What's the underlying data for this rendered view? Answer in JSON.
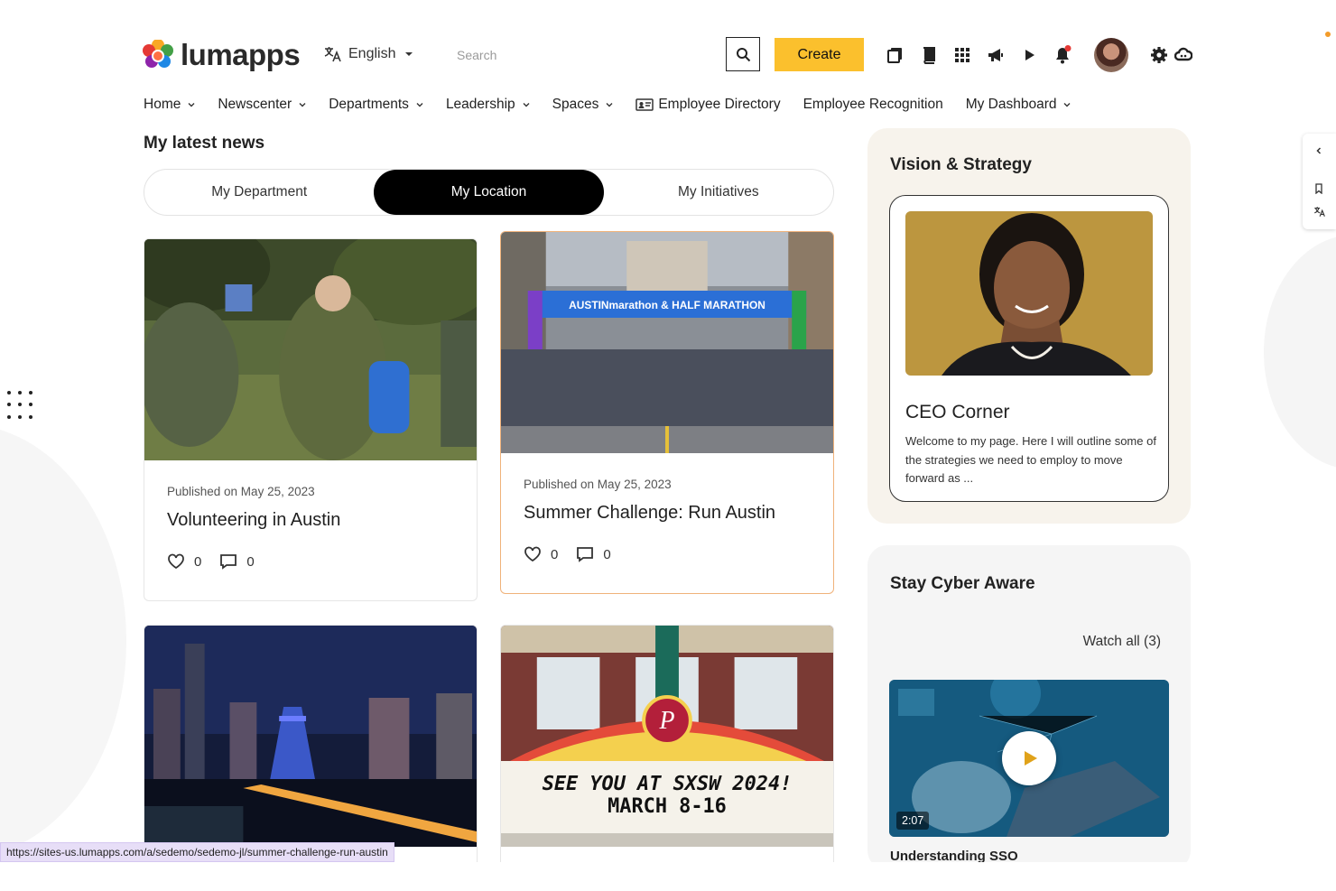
{
  "brand": {
    "name": "lumapps",
    "colors": {
      "accent": "#fbc02d",
      "active_tab": "#000000",
      "notif": "#e53935",
      "highlight_border": "#f0b27a"
    }
  },
  "header": {
    "language": "English",
    "search_placeholder": "Search",
    "create_label": "Create",
    "icons": [
      "pages-icon",
      "book-icon",
      "apps-grid-icon",
      "megaphone-icon",
      "play-icon",
      "bell-icon",
      "settings-icon",
      "cloud-icon"
    ]
  },
  "nav": {
    "items": [
      {
        "label": "Home",
        "dropdown": true
      },
      {
        "label": "Newscenter",
        "dropdown": true
      },
      {
        "label": "Departments",
        "dropdown": true
      },
      {
        "label": "Leadership",
        "dropdown": true
      },
      {
        "label": "Spaces",
        "dropdown": true
      },
      {
        "label": "Employee Directory",
        "dropdown": false
      },
      {
        "label": "Employee Recognition",
        "dropdown": false
      },
      {
        "label": "My Dashboard",
        "dropdown": true
      }
    ]
  },
  "news": {
    "title": "My latest news",
    "tabs": [
      "My Department",
      "My Location",
      "My Initiatives"
    ],
    "active_tab": "My Location",
    "cards": [
      {
        "published": "Published on May 25, 2023",
        "title": "Volunteering in Austin",
        "likes": "0",
        "comments": "0",
        "image": "volunteers-cleanup"
      },
      {
        "published": "Published on May 25, 2023",
        "title": "Summer Challenge: Run Austin",
        "likes": "0",
        "comments": "0",
        "image": "austin-marathon-start",
        "banner": "AUSTINmarathon & HALF MARATHON"
      },
      {
        "image": "austin-skyline-night"
      },
      {
        "image": "paramount-theatre-marquee",
        "marquee_line1": "SEE YOU AT SXSW 2024!",
        "marquee_line2": "MARCH 8-16"
      }
    ]
  },
  "vision": {
    "title": "Vision & Strategy",
    "ceo_title": "CEO Corner",
    "ceo_text": "Welcome to my page. Here I will outline some of the strategies we need to employ to move forward as ..."
  },
  "cyber": {
    "title": "Stay Cyber Aware",
    "watch_all": "Watch all (3)",
    "duration": "2:07",
    "video_title": "Understanding SSO"
  },
  "status_url": "https://sites-us.lumapps.com/a/sedemo/sedemo-jl/summer-challenge-run-austin"
}
